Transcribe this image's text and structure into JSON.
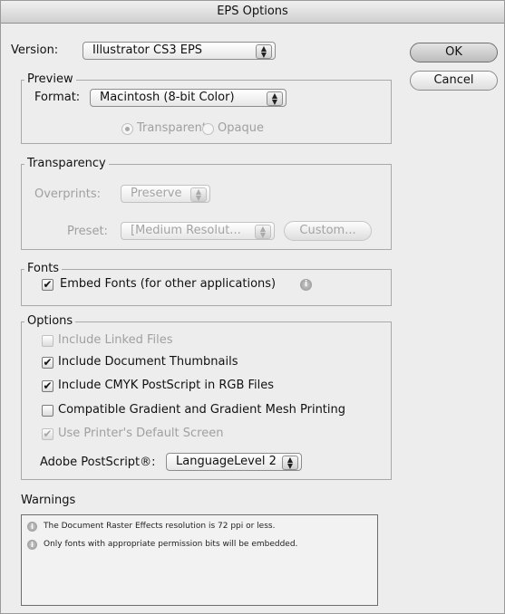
{
  "window": {
    "title": "EPS Options"
  },
  "version": {
    "label": "Version:",
    "selected": "Illustrator CS3 EPS"
  },
  "buttons": {
    "ok": "OK",
    "cancel": "Cancel"
  },
  "preview": {
    "title": "Preview",
    "format_label": "Format:",
    "format_selected": "Macintosh (8-bit Color)",
    "radio_transparent": "Transparent",
    "radio_opaque": "Opaque"
  },
  "transparency": {
    "title": "Transparency",
    "overprints_label": "Overprints:",
    "overprints_selected": "Preserve",
    "preset_label": "Preset:",
    "preset_selected": "[Medium Resolut...",
    "custom_button": "Custom..."
  },
  "fonts": {
    "title": "Fonts",
    "embed_label": "Embed Fonts (for other applications)"
  },
  "options": {
    "title": "Options",
    "include_linked": "Include Linked Files",
    "include_thumbnails": "Include Document Thumbnails",
    "include_cmyk": "Include CMYK PostScript in RGB Files",
    "compatible_gradient": "Compatible Gradient and Gradient Mesh Printing",
    "use_printer_screen": "Use Printer's Default Screen",
    "postscript_label": "Adobe PostScript®:",
    "postscript_selected": "LanguageLevel 2"
  },
  "warnings": {
    "title": "Warnings",
    "items": [
      "The Document Raster Effects resolution is 72 ppi or less.",
      "Only fonts with appropriate permission bits will be embedded."
    ]
  },
  "checkmark": "✔",
  "arrows_glyph": "▲▼"
}
